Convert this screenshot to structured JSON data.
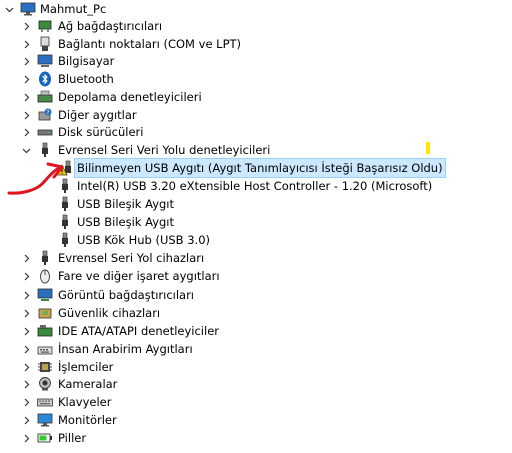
{
  "tree": {
    "root": "Mahmut_Pc",
    "categories_before": [
      {
        "label": "Ağ bağdaştırıcıları",
        "icon": "network-adapter-icon"
      },
      {
        "label": "Bağlantı noktaları (COM ve LPT)",
        "icon": "ports-icon"
      },
      {
        "label": "Bilgisayar",
        "icon": "computer-icon"
      },
      {
        "label": "Bluetooth",
        "icon": "bluetooth-icon"
      },
      {
        "label": "Depolama denetleyicileri",
        "icon": "storage-controller-icon"
      },
      {
        "label": "Diğer aygıtlar",
        "icon": "other-devices-icon"
      },
      {
        "label": "Disk sürücüleri",
        "icon": "disk-drive-icon"
      }
    ],
    "expanded": {
      "label": "Evrensel Seri Veri Yolu denetleyicileri",
      "children": [
        {
          "label": "Bilinmeyen USB Aygıtı (Aygıt Tanımlayıcısı İsteği Başarısız Oldu)",
          "icon": "warning-usb-icon",
          "selected": true
        },
        {
          "label": "Intel(R) USB 3.20 eXtensible Host Controller - 1.20 (Microsoft)",
          "icon": "usb-icon"
        },
        {
          "label": "USB Bileşik Aygıt",
          "icon": "usb-icon"
        },
        {
          "label": "USB Bileşik Aygıt",
          "icon": "usb-icon"
        },
        {
          "label": "USB Kök Hub (USB 3.0)",
          "icon": "usb-icon"
        }
      ]
    },
    "categories_after": [
      {
        "label": "Evrensel Seri Yol cihazları",
        "icon": "usb-devices-icon"
      },
      {
        "label": "Fare ve diğer işaret aygıtları",
        "icon": "mouse-icon"
      },
      {
        "label": "Görüntü bağdaştırıcıları",
        "icon": "display-adapter-icon"
      },
      {
        "label": "Güvenlik cihazları",
        "icon": "security-device-icon"
      },
      {
        "label": "IDE ATA/ATAPI denetleyiciler",
        "icon": "ide-controller-icon"
      },
      {
        "label": "İnsan Arabirim Aygıtları",
        "icon": "hid-icon"
      },
      {
        "label": "İşlemciler",
        "icon": "processor-icon"
      },
      {
        "label": "Kameralar",
        "icon": "camera-icon"
      },
      {
        "label": "Klavyeler",
        "icon": "keyboard-icon"
      },
      {
        "label": "Monitörler",
        "icon": "monitor-icon"
      },
      {
        "label": "Piller",
        "icon": "battery-icon"
      }
    ]
  },
  "colors": {
    "selection_bg": "#cce8ff",
    "annotation_red": "#e0141e",
    "highlight_yellow": "#ffe600",
    "warning_yellow": "#f5c400"
  }
}
